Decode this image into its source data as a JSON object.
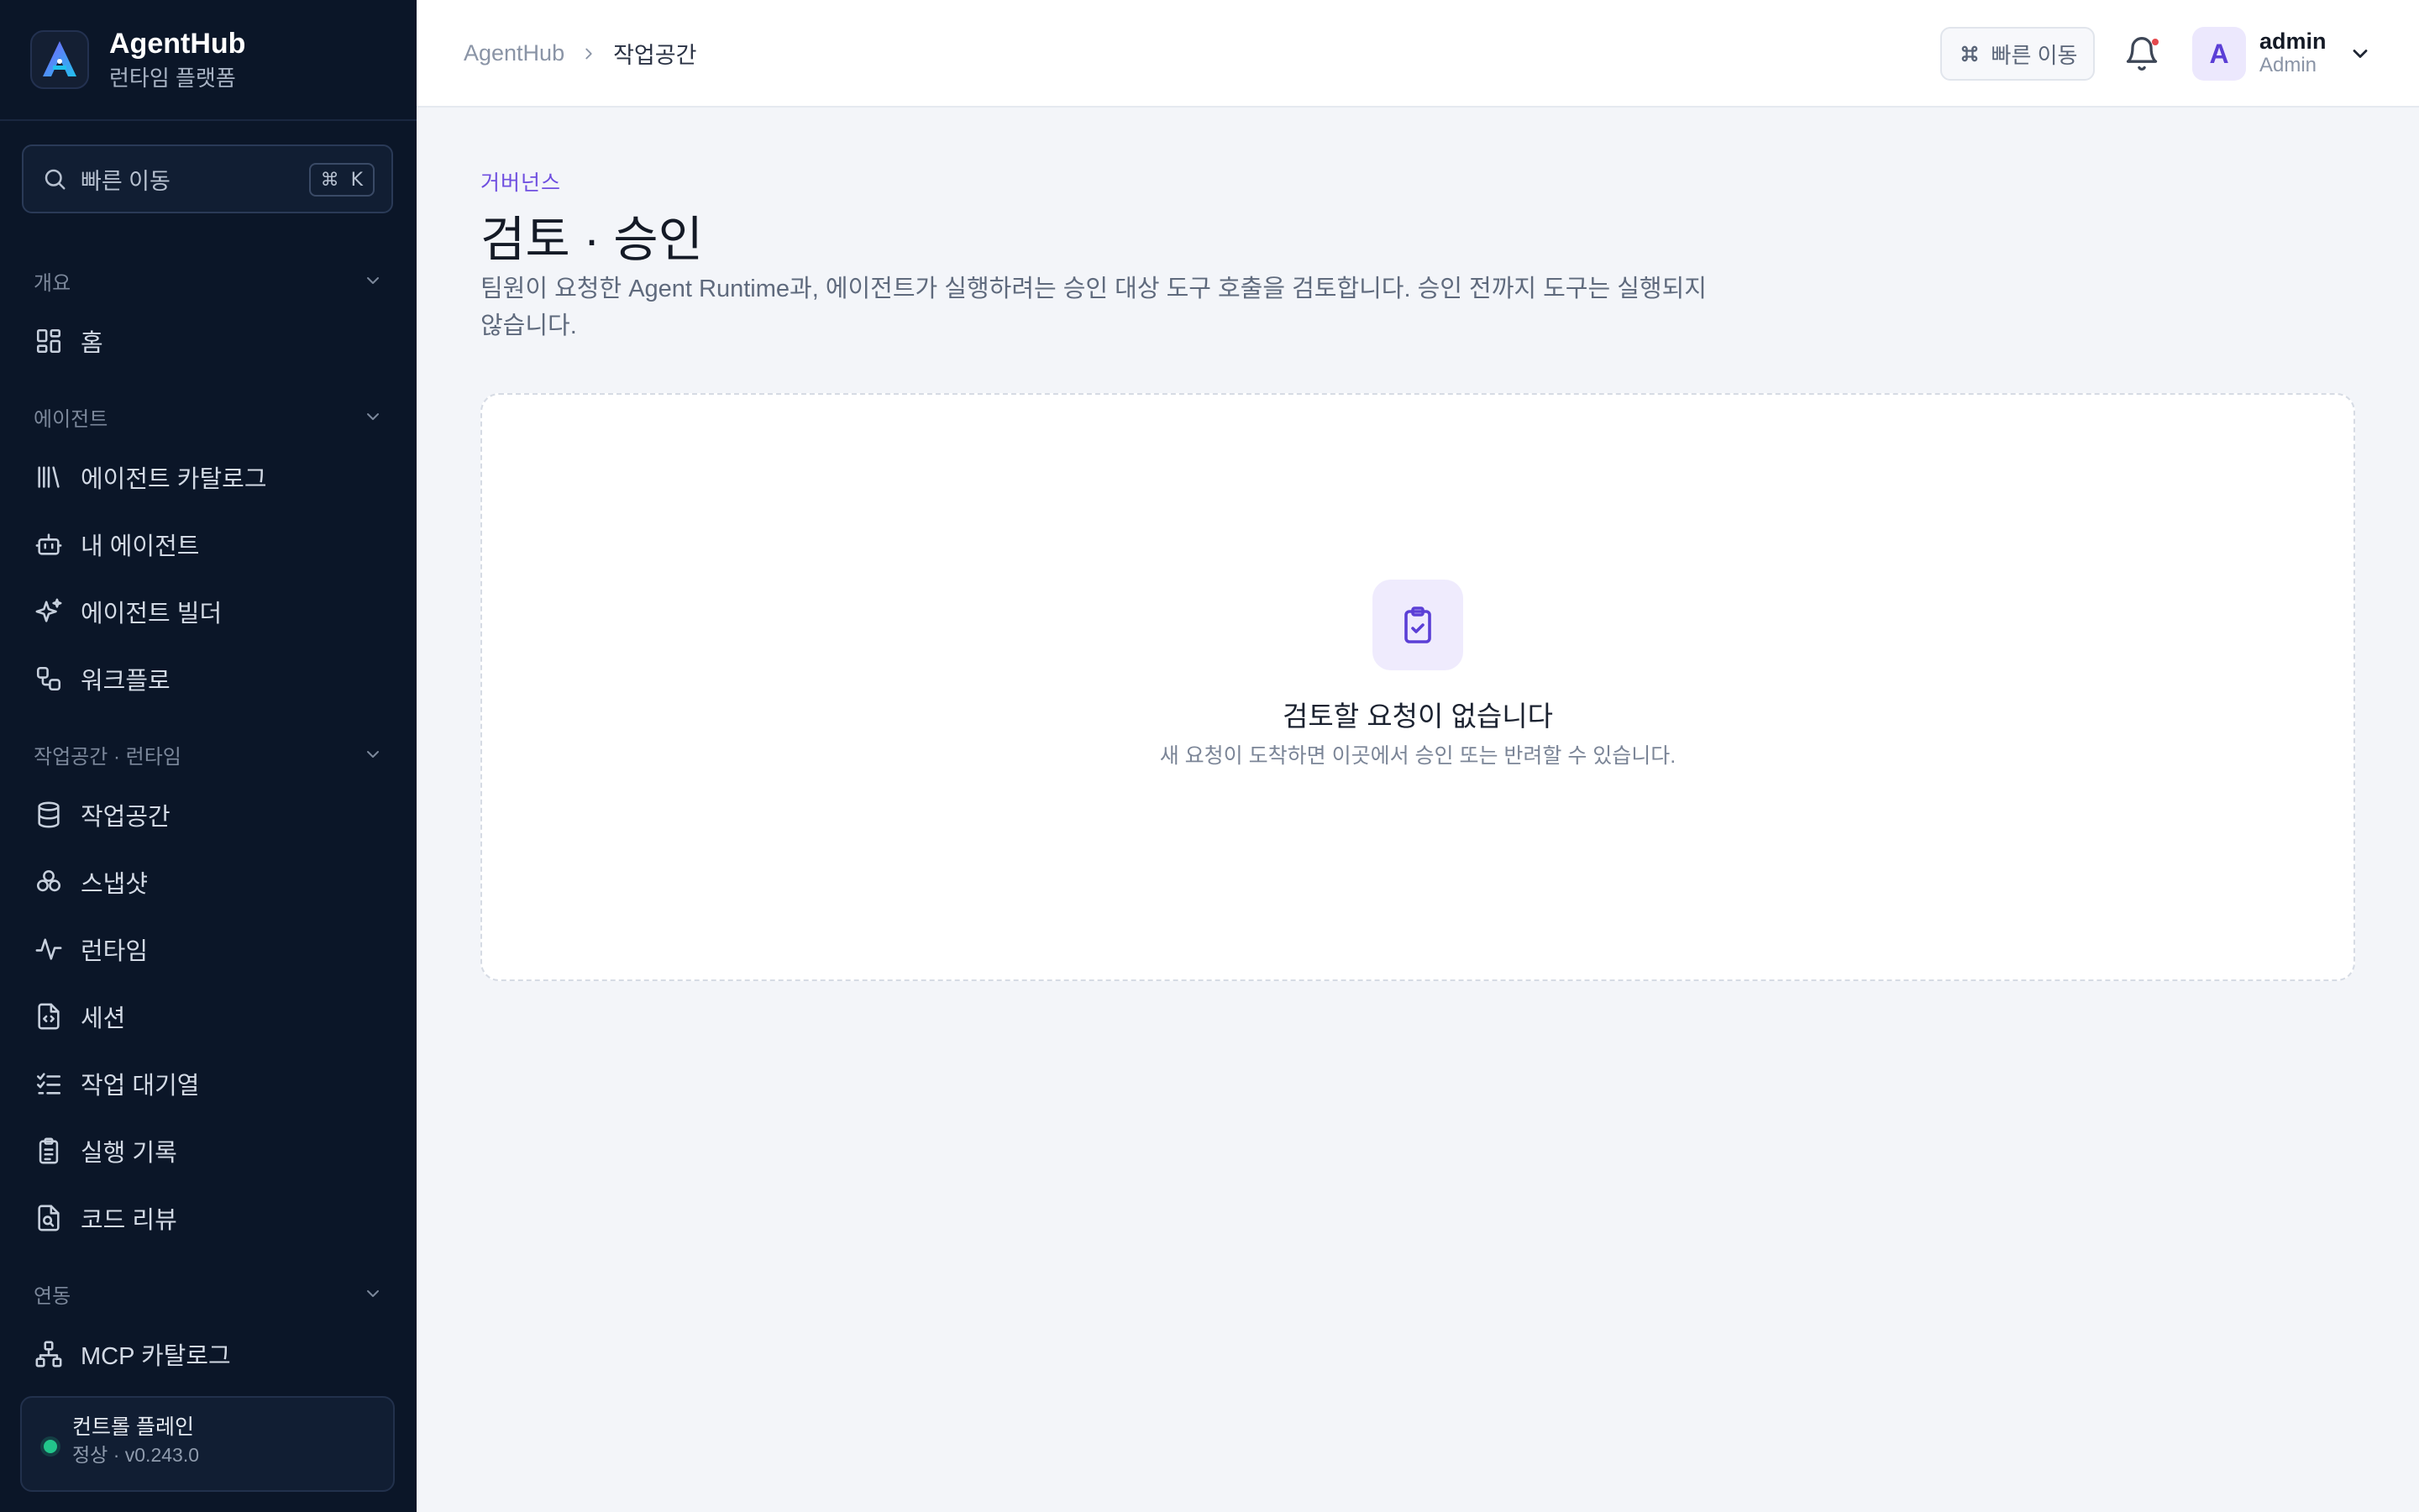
{
  "brand": {
    "name": "AgentHub",
    "subtitle": "런타임 플랫폼"
  },
  "search": {
    "label": "빠른 이동",
    "shortcut_symbol": "⌘",
    "shortcut_key": "K"
  },
  "sidebar": {
    "sections": [
      {
        "title": "개요",
        "items": [
          {
            "label": "홈",
            "icon": "dashboard-icon"
          }
        ]
      },
      {
        "title": "에이전트",
        "items": [
          {
            "label": "에이전트 카탈로그",
            "icon": "library-icon"
          },
          {
            "label": "내 에이전트",
            "icon": "bot-icon"
          },
          {
            "label": "에이전트 빌더",
            "icon": "sparkles-icon"
          },
          {
            "label": "워크플로",
            "icon": "workflow-icon"
          }
        ]
      },
      {
        "title": "작업공간 · 런타임",
        "items": [
          {
            "label": "작업공간",
            "icon": "database-icon"
          },
          {
            "label": "스냅샷",
            "icon": "snapshot-icon"
          },
          {
            "label": "런타임",
            "icon": "activity-icon"
          },
          {
            "label": "세션",
            "icon": "file-code-icon"
          },
          {
            "label": "작업 대기열",
            "icon": "list-checks-icon"
          },
          {
            "label": "실행 기록",
            "icon": "clipboard-list-icon"
          },
          {
            "label": "코드 리뷰",
            "icon": "file-search-icon"
          }
        ]
      },
      {
        "title": "연동",
        "items": [
          {
            "label": "MCP 카탈로그",
            "icon": "network-icon"
          }
        ]
      }
    ],
    "status": {
      "title": "컨트롤 플레인",
      "subtitle": "정상 · v0.243.0",
      "color": "#22c58b"
    }
  },
  "topbar": {
    "breadcrumb_root": "AgentHub",
    "breadcrumb_current": "작업공간",
    "quick_nav_label": "빠른 이동",
    "user": {
      "initial": "A",
      "name": "admin",
      "role": "Admin"
    }
  },
  "main": {
    "eyebrow": "거버넌스",
    "title": "검토 · 승인",
    "description": "팀원이 요청한 Agent Runtime과, 에이전트가 실행하려는 승인 대상 도구 호출을 검토합니다. 승인 전까지 도구는 실행되지 않습니다.",
    "empty_state": {
      "title": "검토할 요청이 없습니다",
      "subtitle": "새 요청이 도착하면 이곳에서 승인 또는 반려할 수 있습니다.",
      "icon": "clipboard-check-icon"
    }
  },
  "colors": {
    "sidebar_bg": "#0b1628",
    "accent": "#6f4fe0",
    "page_bg": "#f3f5f9"
  }
}
